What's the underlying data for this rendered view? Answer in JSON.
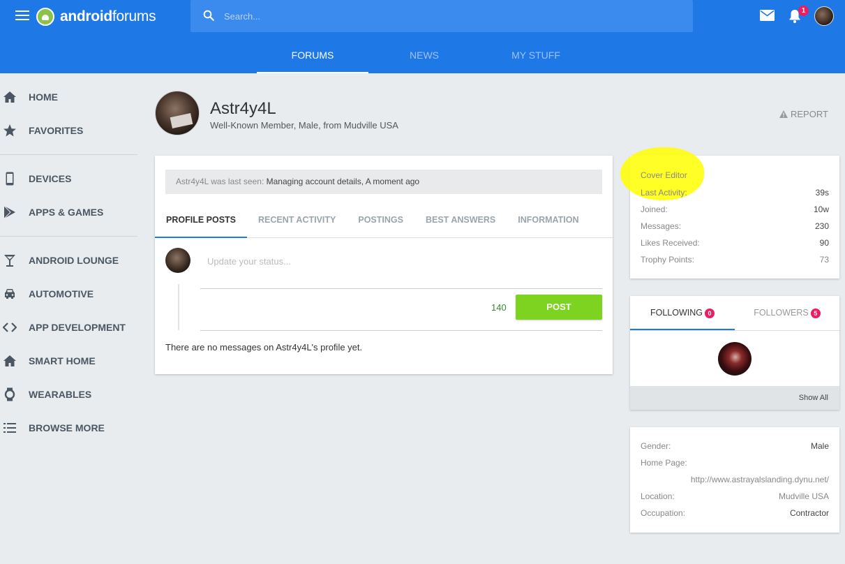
{
  "header": {
    "logo_bold": "android",
    "logo_light": "forums",
    "search_placeholder": "Search...",
    "notification_count": "1",
    "tabs": [
      {
        "label": "FORUMS",
        "active": true
      },
      {
        "label": "NEWS",
        "active": false
      },
      {
        "label": "MY STUFF",
        "active": false
      }
    ]
  },
  "sidebar": {
    "items": [
      {
        "label": "HOME",
        "icon": "home-icon"
      },
      {
        "label": "FAVORITES",
        "icon": "star-icon"
      },
      {
        "label": "DEVICES",
        "icon": "phone-icon"
      },
      {
        "label": "APPS & GAMES",
        "icon": "play-store-icon"
      },
      {
        "label": "ANDROID LOUNGE",
        "icon": "cocktail-icon"
      },
      {
        "label": "AUTOMOTIVE",
        "icon": "car-icon"
      },
      {
        "label": "APP DEVELOPMENT",
        "icon": "code-icon"
      },
      {
        "label": "SMART HOME",
        "icon": "home-icon"
      },
      {
        "label": "WEARABLES",
        "icon": "watch-icon"
      },
      {
        "label": "BROWSE MORE",
        "icon": "list-icon"
      }
    ]
  },
  "profile": {
    "name": "Astr4y4L",
    "subtitle": "Well-Known Member, Male, from Mudville USA",
    "report_label": "REPORT",
    "last_seen_prefix": "Astr4y4L was last seen:",
    "last_seen_value": "Managing account details, A moment ago",
    "tabs": [
      "PROFILE POSTS",
      "RECENT ACTIVITY",
      "POSTINGS",
      "BEST ANSWERS",
      "INFORMATION"
    ],
    "status_placeholder": "Update your status...",
    "char_count": "140",
    "post_label": "POST",
    "no_messages": "There are no messages on Astr4y4L's profile yet."
  },
  "stats": {
    "title": "Cover Editor",
    "rows": [
      {
        "label": "Last Activity:",
        "value": "39s"
      },
      {
        "label": "Joined:",
        "value": "10w"
      },
      {
        "label": "Messages:",
        "value": "230"
      },
      {
        "label": "Likes Received:",
        "value": "90"
      },
      {
        "label": "Trophy Points:",
        "value": "73"
      }
    ]
  },
  "follow": {
    "following_label": "FOLLOWING",
    "following_count": "0",
    "followers_label": "FOLLOWERS",
    "followers_count": "5",
    "show_all": "Show All"
  },
  "info": {
    "gender_label": "Gender:",
    "gender_value": "Male",
    "homepage_label": "Home Page:",
    "homepage_value": "http://www.astrayalslanding.dynu.net/",
    "location_label": "Location:",
    "location_value": "Mudville USA",
    "occupation_label": "Occupation:",
    "occupation_value": "Contractor"
  },
  "colors": {
    "brand_blue": "#1e78e6",
    "post_green": "#7ed321",
    "badge_pink": "#e91e63",
    "highlight_yellow": "#ffff00"
  }
}
